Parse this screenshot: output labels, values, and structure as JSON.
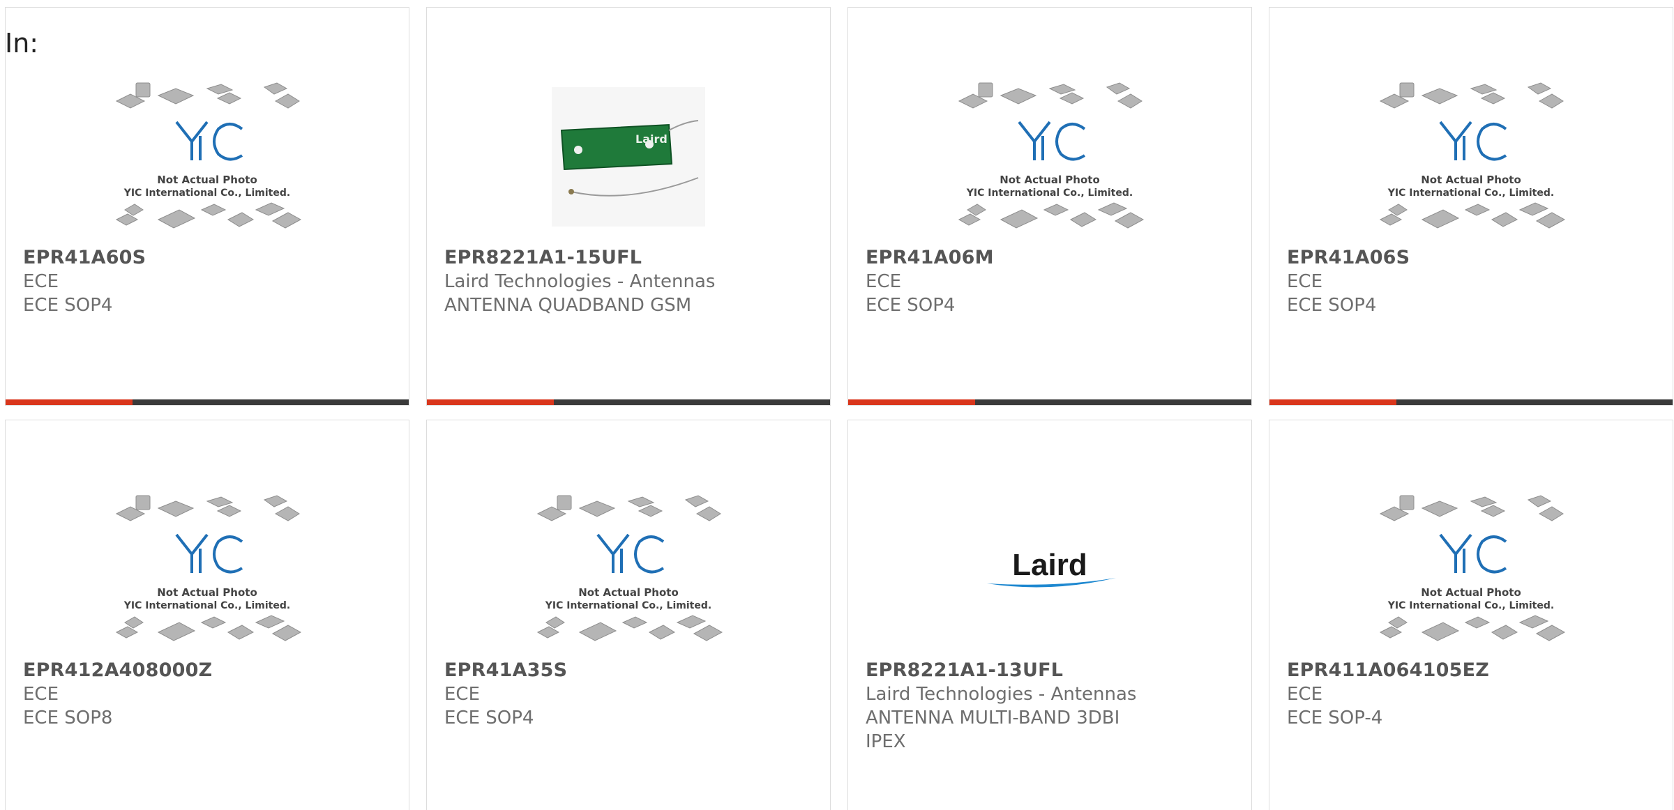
{
  "filter": {
    "label": "In:"
  },
  "placeholder_image": {
    "brand_text": "YIC",
    "line1": "Not Actual Photo",
    "line2": "YIC International Co., Limited."
  },
  "laird_logo_text": "Laird",
  "antenna_label": "Laird",
  "products": [
    {
      "part_number": "EPR41A60S",
      "manufacturer": "ECE",
      "description": "ECE SOP4",
      "image": "yic-placeholder"
    },
    {
      "part_number": "EPR8221A1-15UFL",
      "manufacturer": "Laird Technologies - Antennas",
      "description": "ANTENNA QUADBAND GSM",
      "image": "antenna-photo"
    },
    {
      "part_number": "EPR41A06M",
      "manufacturer": "ECE",
      "description": "ECE SOP4",
      "image": "yic-placeholder"
    },
    {
      "part_number": "EPR41A06S",
      "manufacturer": "ECE",
      "description": "ECE SOP4",
      "image": "yic-placeholder"
    },
    {
      "part_number": "EPR412A408000Z",
      "manufacturer": "ECE",
      "description": "ECE SOP8",
      "image": "yic-placeholder"
    },
    {
      "part_number": "EPR41A35S",
      "manufacturer": "ECE",
      "description": "ECE SOP4",
      "image": "yic-placeholder"
    },
    {
      "part_number": "EPR8221A1-13UFL",
      "manufacturer": "Laird Technologies - Antennas",
      "description": "ANTENNA MULTI-BAND 3DBI IPEX",
      "image": "laird-logo"
    },
    {
      "part_number": "EPR411A064105EZ",
      "manufacturer": "ECE",
      "description": "ECE SOP-4",
      "image": "yic-placeholder"
    }
  ],
  "colors": {
    "accent_bar": "#d9361c",
    "dark_bar": "#3a3a3a",
    "yic_blue": "#1f6fb5",
    "laird_blue": "#1e88d0"
  }
}
